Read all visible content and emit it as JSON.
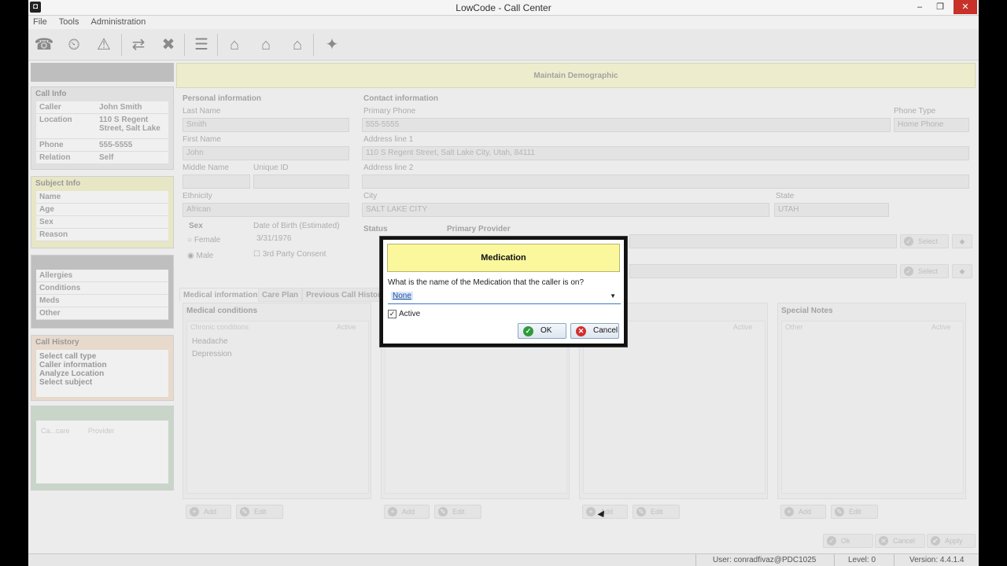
{
  "window": {
    "title": "LowCode - Call Center"
  },
  "menu": [
    "File",
    "Tools",
    "Administration"
  ],
  "sidebar": {
    "call_info": {
      "header": "Call Info",
      "rows": [
        {
          "k": "Caller",
          "v": "John Smith"
        },
        {
          "k": "Location",
          "v": "110 S Regent Street, Salt Lake"
        },
        {
          "k": "Phone",
          "v": "555-5555"
        },
        {
          "k": "Relation",
          "v": "Self"
        }
      ]
    },
    "subject_info": {
      "header": "Subject Info",
      "rows": [
        "Name",
        "Age",
        "Sex",
        "Reason"
      ]
    },
    "medical": {
      "rows": [
        "Allergies",
        "Conditions",
        "Meds",
        "Other"
      ]
    },
    "call_history": {
      "header": "Call History",
      "rows": [
        "Select call type",
        "Caller information",
        "Analyze Location",
        "Select subject"
      ]
    },
    "bottom": {
      "col1": "Ca...care",
      "col2": "Provider"
    }
  },
  "main": {
    "banner": "Maintain Demographic",
    "personal": {
      "header": "Personal information",
      "last_name_label": "Last Name",
      "last_name": "Smith",
      "first_name_label": "First Name",
      "first_name": "John",
      "middle_label": "Middle Name",
      "unique_label": "Unique ID",
      "ethnicity_label": "Ethnicity",
      "ethnicity": "African",
      "sex_label": "Sex",
      "female": "Female",
      "male": "Male",
      "dob_label": "Date of Birth (Estimated)",
      "dob": "3/31/1976",
      "third_party": "3rd Party Consent"
    },
    "contact": {
      "header": "Contact information",
      "primary_phone_label": "Primary Phone",
      "primary_phone": "555-5555",
      "phone_type_label": "Phone Type",
      "phone_type": "Home Phone",
      "address1_label": "Address line 1",
      "address1": "110 S Regent Street, Salt Lake City, Utah, 84111",
      "address2_label": "Address line 2",
      "city_label": "City",
      "city": "SALT LAKE CITY",
      "state_label": "State",
      "state": "UTAH",
      "status_label": "Status",
      "provider_label": "Primary Provider",
      "select_label": "Select"
    },
    "tabs": [
      "Medical information",
      "Care Plan",
      "Previous Call History"
    ],
    "columns": [
      {
        "header": "Medical conditions",
        "col_a": "Chronic conditions",
        "col_b": "Active",
        "items": [
          "Headache",
          "Depression"
        ]
      },
      {
        "header": "",
        "col_a": "",
        "col_b": "",
        "items": []
      },
      {
        "header": "",
        "col_a": "",
        "col_b": "Active",
        "items": []
      },
      {
        "header": "Special Notes",
        "col_a": "Other",
        "col_b": "Active",
        "items": []
      }
    ],
    "add_label": "Add",
    "edit_label": "Edit",
    "footer": {
      "ok": "Ok",
      "cancel": "Cancel",
      "apply": "Apply"
    }
  },
  "dialog": {
    "title": "Medication",
    "question": "What is the name of the Medication that the caller is on?",
    "selected": "None",
    "active_label": "Active",
    "active_checked": true,
    "ok_label": "OK",
    "cancel_label": "Cancel"
  },
  "status": {
    "user": "User: conradfivaz@PDC1025",
    "level": "Level: 0",
    "version": "Version: 4.4.1.4"
  },
  "colors": {
    "dialog_title_bg": "#faf79d",
    "banner_bg": "#eeeeb4",
    "close_red": "#c7312a"
  }
}
